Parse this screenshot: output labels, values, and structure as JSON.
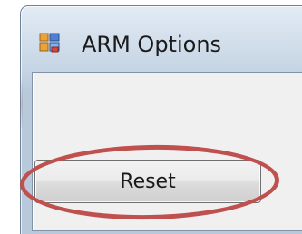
{
  "window": {
    "title": "ARM Options",
    "icon": "app-window-icon"
  },
  "buttons": {
    "reset_label": "Reset"
  },
  "annotation": {
    "type": "highlight-oval",
    "color": "#c0504d"
  }
}
